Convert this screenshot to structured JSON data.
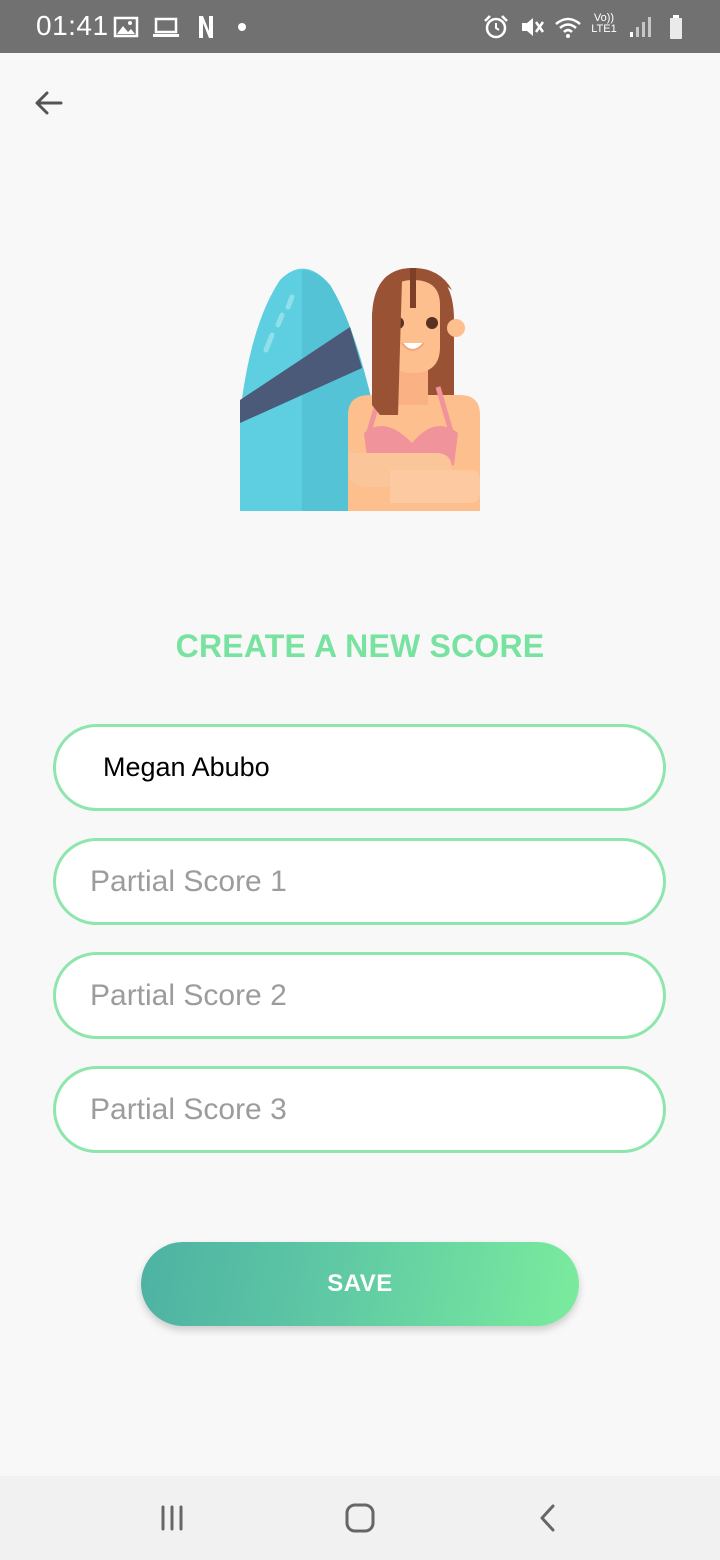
{
  "status_bar": {
    "time": "01:41",
    "left_icons": [
      "image-icon",
      "laptop-icon",
      "netflix-icon",
      "dot-icon"
    ],
    "right_icons": [
      "alarm-icon",
      "mute-icon",
      "wifi-icon",
      "volte-icon",
      "signal-icon",
      "battery-icon"
    ],
    "volte_line1": "Vo))",
    "volte_line2": "LTE1"
  },
  "header": {
    "back_icon": "arrow-left-icon"
  },
  "illustration": {
    "name": "surfer-girl-illustration"
  },
  "form": {
    "title": "CREATE A NEW SCORE",
    "name_value": "Megan Abubo",
    "score1_placeholder": "Partial Score 1",
    "score2_placeholder": "Partial Score 2",
    "score3_placeholder": "Partial Score 3",
    "save_label": "SAVE"
  },
  "colors": {
    "accent_green": "#78e2a0",
    "field_border": "#8ee6ad",
    "button_gradient_start": "#4db2a3",
    "button_gradient_end": "#7aec9d",
    "status_bar": "#717171"
  },
  "nav_bar": {
    "buttons": [
      "recents-icon",
      "home-icon",
      "back-icon"
    ]
  }
}
